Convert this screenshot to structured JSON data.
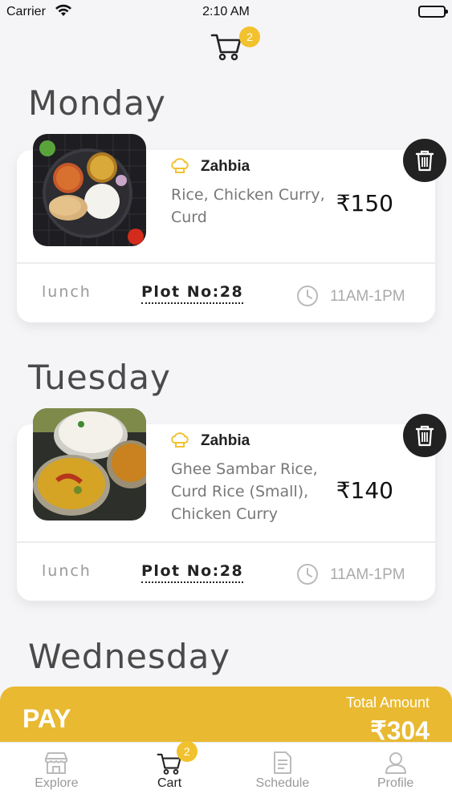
{
  "status_bar": {
    "carrier": "Carrier",
    "time": "2:10 AM"
  },
  "header": {
    "cart_badge": "2"
  },
  "days": [
    {
      "day": "Monday",
      "vendor": "Zahbia",
      "items": [
        "Rice, Chicken Curry,",
        "Curd"
      ],
      "price": "₹150",
      "meal": "lunch",
      "plot": "Plot No:28",
      "time_slot": "11AM-1PM"
    },
    {
      "day": "Tuesday",
      "vendor": "Zahbia",
      "items": [
        "Ghee Sambar Rice,",
        "Curd Rice (Small),",
        "Chicken Curry"
      ],
      "price": "₹140",
      "meal": "lunch",
      "plot": "Plot No:28",
      "time_slot": "11AM-1PM"
    },
    {
      "day": "Wednesday"
    }
  ],
  "pay_bar": {
    "pay_label": "PAY",
    "total_label": "Total Amount",
    "total_value": "₹304"
  },
  "tab_bar": {
    "tabs": [
      {
        "label": "Explore",
        "icon": "store-icon"
      },
      {
        "label": "Cart",
        "icon": "cart-icon",
        "badge": "2"
      },
      {
        "label": "Schedule",
        "icon": "document-icon"
      },
      {
        "label": "Profile",
        "icon": "user-icon"
      }
    ]
  },
  "colors": {
    "accent": "#e8b931",
    "badge": "#f2c12e",
    "delete_bg": "#222222"
  }
}
